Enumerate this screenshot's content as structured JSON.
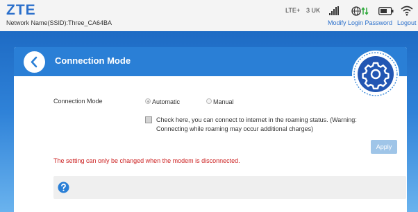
{
  "header": {
    "brand": "ZTE",
    "ssid_text": "Network Name(SSID):Three_CA64BA",
    "network_type": "LTE+",
    "carrier": "3 UK",
    "modify_password_link": "Modify Login Password",
    "logout_link": "Logout",
    "icons": [
      "signal-icon",
      "globe-icon",
      "battery-icon",
      "wifi-icon"
    ]
  },
  "panel": {
    "title": "Connection Mode",
    "back_icon": "back-arrow-icon",
    "badge_icon": "gear-icon"
  },
  "form": {
    "connection_mode_label": "Connection Mode",
    "options": [
      "Automatic",
      "Manual"
    ],
    "selected": "Automatic",
    "roaming_checked": false,
    "roaming_text": "Check here, you can connect to internet in the roaming status. (Warning: Connecting while roaming may occur additional charges)",
    "apply_label": "Apply",
    "warning_text": "The setting can only be changed when the modem is disconnected."
  },
  "help": {
    "icon": "help-icon"
  },
  "colors": {
    "brand": "#2a6fcb",
    "header_blue": "#2a7fd6",
    "warning_red": "#cc1f1f",
    "apply_disabled": "#9fc5e8"
  }
}
